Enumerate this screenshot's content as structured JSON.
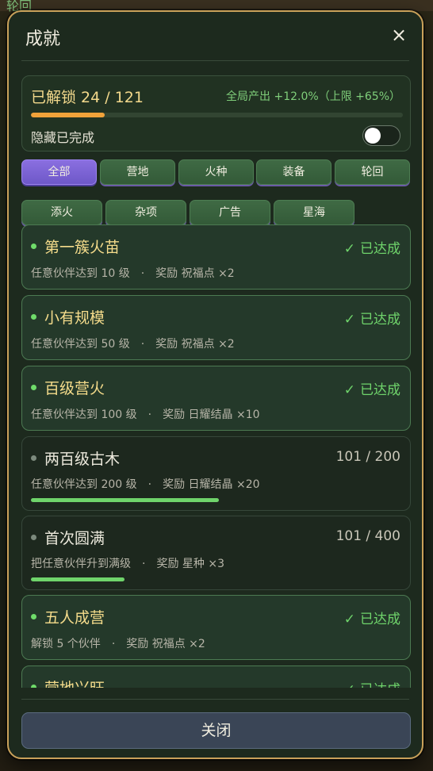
{
  "background": {
    "top_label": "轮回"
  },
  "modal": {
    "title": "成就",
    "close_icon": "×"
  },
  "summary": {
    "unlocked_label": "已解锁 24 / 121",
    "unlocked": 24,
    "total": 121,
    "production": "全局产出 +12.0%（上限 +65%）",
    "hide_completed_label": "隐藏已完成",
    "hide_completed": false
  },
  "filters": [
    {
      "label": "全部",
      "active": true
    },
    {
      "label": "营地",
      "active": false
    },
    {
      "label": "火种",
      "active": false
    },
    {
      "label": "装备",
      "active": false
    },
    {
      "label": "轮回",
      "active": false
    },
    {
      "label": "添火",
      "active": false
    },
    {
      "label": "杂项",
      "active": false
    },
    {
      "label": "广告",
      "active": false
    },
    {
      "label": "星海",
      "active": false
    }
  ],
  "achievements": [
    {
      "title": "第一簇火苗",
      "status": "已达成",
      "desc": "任意伙伴达到 10 级",
      "sep": "·",
      "reward": "奖励 祝福点 ×2",
      "done": true
    },
    {
      "title": "小有规模",
      "status": "已达成",
      "desc": "任意伙伴达到 50 级",
      "sep": "·",
      "reward": "奖励 祝福点 ×2",
      "done": true
    },
    {
      "title": "百级营火",
      "status": "已达成",
      "desc": "任意伙伴达到 100 级",
      "sep": "·",
      "reward": "奖励 日耀结晶 ×10",
      "done": true
    },
    {
      "title": "两百级古木",
      "count": "101 / 200",
      "desc": "任意伙伴达到 200 级",
      "sep": "·",
      "reward": "奖励 日耀结晶 ×20",
      "done": false,
      "progress": 0.505
    },
    {
      "title": "首次圆满",
      "count": "101 / 400",
      "desc": "把任意伙伴升到满级",
      "sep": "·",
      "reward": "奖励 星种 ×3",
      "done": false,
      "progress": 0.2525
    },
    {
      "title": "五人成营",
      "status": "已达成",
      "desc": "解锁 5 个伙伴",
      "sep": "·",
      "reward": "奖励 祝福点 ×2",
      "done": true
    },
    {
      "title": "营地兴旺",
      "status": "已达成",
      "desc": "",
      "sep": "",
      "reward": "",
      "done": true
    }
  ],
  "footer": {
    "close_label": "关闭"
  },
  "colors": {
    "accent_gold": "#c9a15a",
    "done_green": "#6fd46b",
    "active_filter": "#7a62d6",
    "progress_orange": "#f0a23a"
  }
}
